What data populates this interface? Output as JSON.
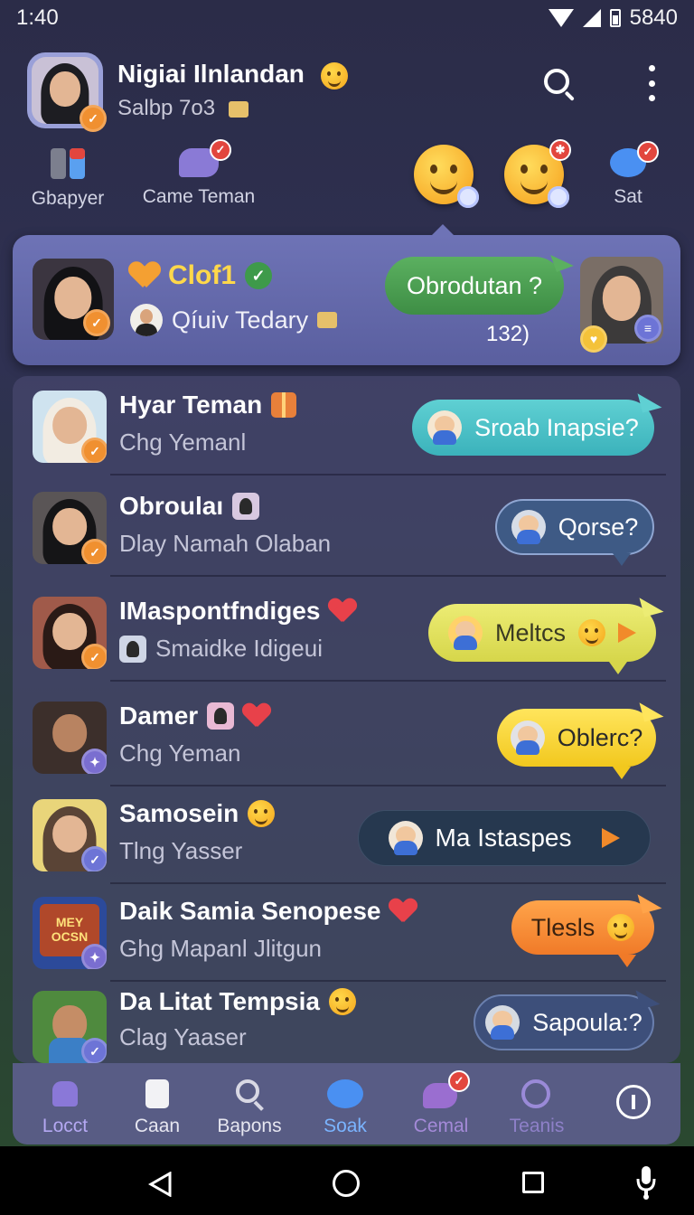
{
  "status_bar": {
    "time": "1:40",
    "battery": "5840"
  },
  "profile": {
    "name": "Nigiai Ilnlandan",
    "subtitle": "Salbp 7o3"
  },
  "quick_actions": [
    {
      "label": "Gbapyer"
    },
    {
      "label": "Came Teman"
    },
    {
      "label": "Sat"
    }
  ],
  "pinned": {
    "title": "Clof1",
    "subtitle": "Qíuiv Tedary",
    "bubble": "Obrodutan ?",
    "count": "132)"
  },
  "chats": [
    {
      "name": "Hyar Teman",
      "sub": "Chg Yemanl",
      "bubble": "Sroab Inapsie?"
    },
    {
      "name": "Obroulaı",
      "sub": "Dlay Namah Olaban",
      "bubble": "Qorse?"
    },
    {
      "name": "IMaspontfndiges",
      "sub": "Smaidke Idigeui",
      "bubble": "Meltcs"
    },
    {
      "name": "Damer",
      "sub": "Chg Yeman",
      "bubble": "Oblerc?"
    },
    {
      "name": "Samosein",
      "sub": "Tlng Yasser",
      "bubble": "Ma Istaspes"
    },
    {
      "name": "Daik Samia Senopese",
      "sub": "Ghg Mapanl Jlitgun",
      "bubble": "Tlesls"
    },
    {
      "name": "Da Litat Tempsia",
      "sub": "Clag Yaaser",
      "bubble": "Sapoula:?"
    }
  ],
  "sticker_text": "MEY OCSN",
  "nav": [
    {
      "label": "Locct"
    },
    {
      "label": "Caan"
    },
    {
      "label": "Bapons"
    },
    {
      "label": "Soak"
    },
    {
      "label": "Cemal"
    },
    {
      "label": "Teanis"
    }
  ],
  "colors": {
    "accent_green": "#3e8e45",
    "accent_teal": "#4cc4c8",
    "accent_yellow": "#e8e25a",
    "accent_orange": "#f18a2a",
    "badge_orange": "#f09030",
    "title_gold": "#ffd84a"
  }
}
